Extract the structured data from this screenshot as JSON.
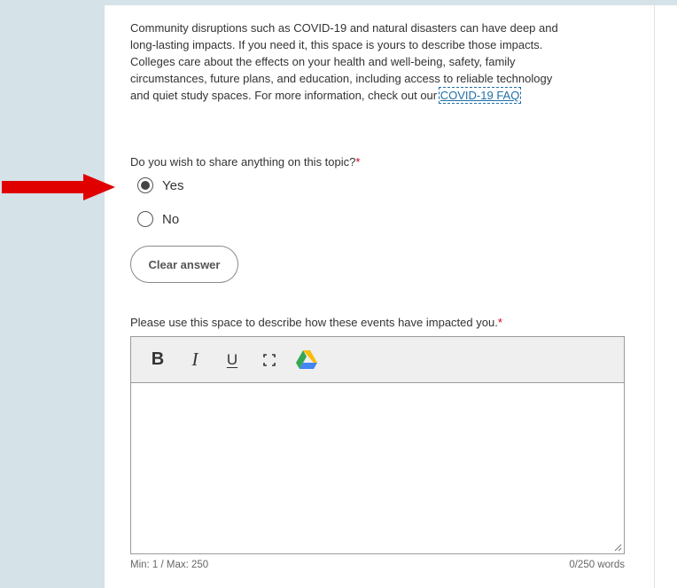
{
  "intro": {
    "text": "Community disruptions such as COVID-19 and natural disasters can have deep and long-lasting impacts. If you need it, this space is yours to describe those impacts. Colleges care about the effects on your health and well-being, safety, family circumstances, future plans, and education, including access to reliable technology and quiet study spaces. For more information, check out our",
    "link_text": "COVID-19 FAQ"
  },
  "question": {
    "label": "Do you wish to share anything on this topic?",
    "required_marker": "*",
    "options": [
      {
        "label": "Yes",
        "selected": true
      },
      {
        "label": "No",
        "selected": false
      }
    ],
    "clear_label": "Clear answer"
  },
  "description": {
    "prompt": "Please use this space to describe how these events have impacted you.",
    "required_marker": "*",
    "value": "",
    "toolbar": {
      "bold_label": "B",
      "italic_label": "I",
      "underline_label": "U",
      "icons": [
        "fullscreen-icon",
        "google-drive-icon"
      ]
    },
    "limits": "Min: 1 / Max: 250",
    "word_count": "0/250 words"
  },
  "colors": {
    "sidebar_bg": "#d5e2e8",
    "arrow": "#e00000",
    "link": "#1f6fa8",
    "required": "#d0021b"
  }
}
